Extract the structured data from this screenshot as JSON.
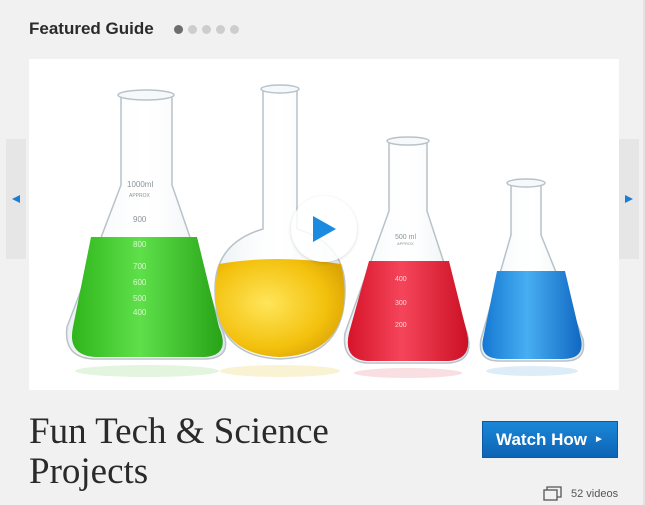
{
  "header": {
    "title": "Featured Guide"
  },
  "pagination": {
    "total": 5,
    "active": 1
  },
  "guide": {
    "title_line1": "Fun Tech & Science",
    "title_line2": "Projects",
    "watch_label": "Watch How",
    "video_count": "52 videos"
  },
  "flasks": {
    "left": {
      "color": "#3ec72a",
      "scale": [
        "1000ml",
        "900",
        "800",
        "700",
        "600",
        "500",
        "400"
      ],
      "approx": "APPROX"
    },
    "round": {
      "color": "#f1c511"
    },
    "red": {
      "color": "#e8263a",
      "scale": [
        "500 ml",
        "400",
        "300",
        "200"
      ],
      "approx": "APPROX"
    },
    "blue": {
      "color": "#1f8fe2"
    }
  },
  "colors": {
    "accent": "#0d64b4",
    "play": "#1a8be0"
  },
  "icons": {
    "prev": "left-arrow-icon",
    "next": "right-arrow-icon",
    "play": "play-icon",
    "videos": "video-stack-icon"
  }
}
